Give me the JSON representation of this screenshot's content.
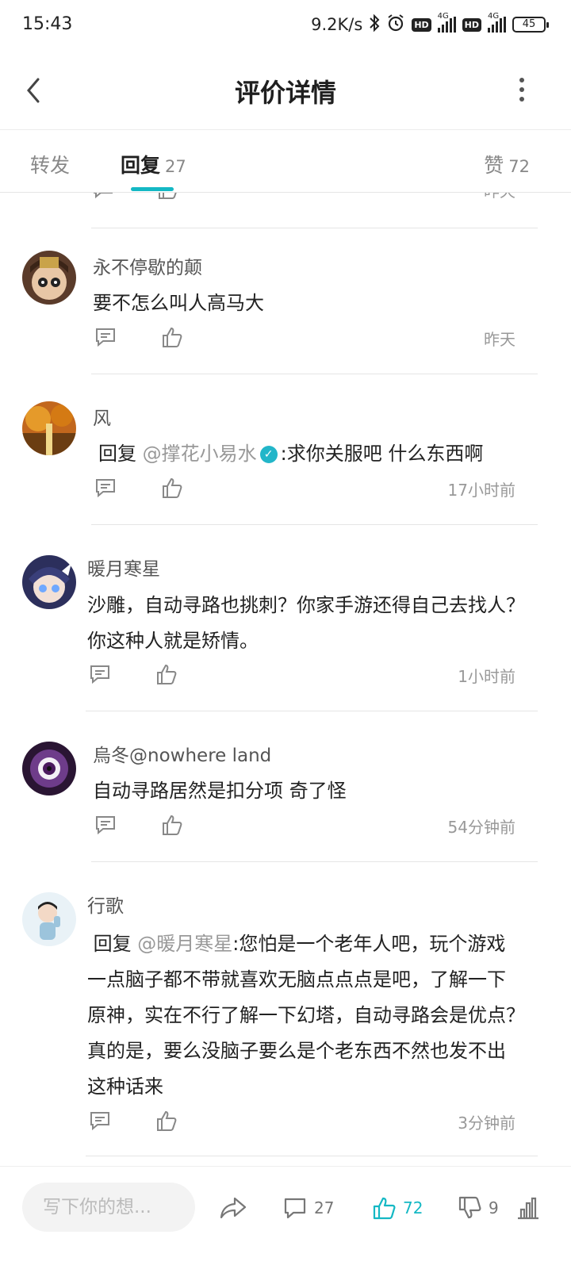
{
  "status_bar": {
    "time": "15:43",
    "speed": "9.2K/s",
    "net1": "4G",
    "net2": "4G",
    "battery": "45"
  },
  "header": {
    "title": "评价详情"
  },
  "tabs": {
    "repost": {
      "label": "转发"
    },
    "reply": {
      "label": "回复",
      "count": "27"
    },
    "like": {
      "label": "赞",
      "count": "72"
    }
  },
  "partial_item": {
    "time": "昨天"
  },
  "comments": [
    {
      "user": "永不停歇的颠",
      "text": "要不怎么叫人高马大",
      "time": "昨天"
    },
    {
      "user": "风",
      "reply_word": "回复",
      "mention": "@撑花小易水",
      "text": ":求你关服吧 什么东西啊",
      "time": "17小时前"
    },
    {
      "user": "暖月寒星",
      "line1": "沙雕，自动寻路也挑刺？你家手游还得自己去找人？",
      "line2": "你这种人就是矫情。",
      "time": "1小时前"
    },
    {
      "user": "烏冬@nowhere land",
      "text": "自动寻路居然是扣分项 奇了怪",
      "time": "54分钟前"
    },
    {
      "user": "行歌",
      "reply_word": "回复",
      "mention": "@暖月寒星",
      "line1": ":您怕是一个老年人吧，玩个游戏",
      "line2": "一点脑子都不带就喜欢无脑点点点是吧，了解一下",
      "line3": "原神，实在不行了解一下幻塔，自动寻路会是优点？",
      "line4": "真的是，要么没脑子要么是个老东西不然也发不出",
      "line5": "这种话来",
      "time": "3分钟前"
    }
  ],
  "bottom_bar": {
    "input_placeholder": "写下你的想...",
    "comment_count": "27",
    "like_count": "72",
    "dislike_count": "9"
  },
  "colors": {
    "accent": "#14b8c4",
    "muted": "#999999",
    "text": "#222222"
  }
}
